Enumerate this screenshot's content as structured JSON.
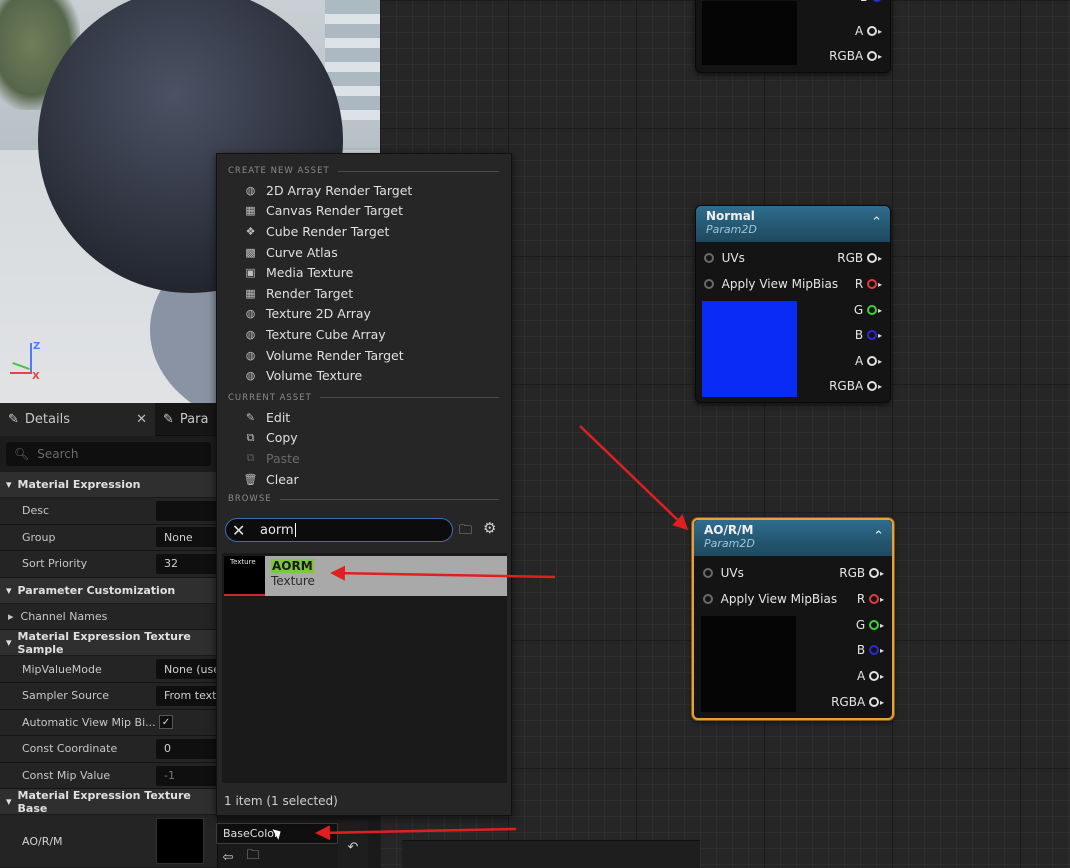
{
  "viewport": {
    "axis_z": "Z",
    "axis_x": "X"
  },
  "details": {
    "tab_details": "Details",
    "tab_params": "Para",
    "search_placeholder": "Search",
    "categories": {
      "material_expression": "Material Expression",
      "parameter_customization": "Parameter Customization",
      "texture_sample": "Material Expression Texture Sample",
      "texture_base": "Material Expression Texture Base"
    },
    "props": {
      "desc": "Desc",
      "desc_value": "",
      "group": "Group",
      "group_value": "None",
      "sort_priority": "Sort Priority",
      "sort_priority_value": "32",
      "channel_names": "Channel Names",
      "mip_value_mode": "MipValueMode",
      "mip_value_mode_value": "None (use",
      "sampler_source": "Sampler Source",
      "sampler_source_value": "From textu",
      "auto_view_mip": "Automatic View Mip Bi...",
      "auto_view_mip_check": "✓",
      "const_coordinate": "Const Coordinate",
      "const_coordinate_value": "0",
      "const_mip_value": "Const Mip Value",
      "const_mip_value_value": "-1",
      "aorm": "AO/R/M"
    }
  },
  "popup": {
    "create_new_asset": "CREATE NEW ASSET",
    "create_items": [
      "2D Array Render Target",
      "Canvas Render Target",
      "Cube Render Target",
      "Curve Atlas",
      "Media Texture",
      "Render Target",
      "Texture 2D Array",
      "Texture Cube Array",
      "Volume Render Target",
      "Volume Texture"
    ],
    "current_asset": "CURRENT ASSET",
    "current_items": [
      "Edit",
      "Copy",
      "Paste",
      "Clear"
    ],
    "browse": "BROWSE",
    "search_value": "aorm",
    "result_thumb_label": "Texture",
    "result_name": "AORM",
    "result_type": "Texture",
    "count": "1 item (1 selected)"
  },
  "combo": {
    "value": "BaseColor"
  },
  "nodes": {
    "top": {
      "pins": [
        "B",
        "A",
        "RGBA"
      ]
    },
    "normal": {
      "title": "Normal",
      "subtitle": "Param2D",
      "inputs": [
        "UVs",
        "Apply View MipBias"
      ],
      "outputs": [
        "RGB",
        "R",
        "G",
        "B",
        "A",
        "RGBA"
      ],
      "preview_color": "#0a2af5"
    },
    "aorm": {
      "title": "AO/R/M",
      "subtitle": "Param2D",
      "inputs": [
        "UVs",
        "Apply View MipBias"
      ],
      "outputs": [
        "RGB",
        "R",
        "G",
        "B",
        "A",
        "RGBA"
      ],
      "preview_color": "#050505"
    }
  },
  "colors": {
    "selection_border": "#e8a13a",
    "arrow": "#e02020",
    "search_highlight": "#7ec63a"
  }
}
